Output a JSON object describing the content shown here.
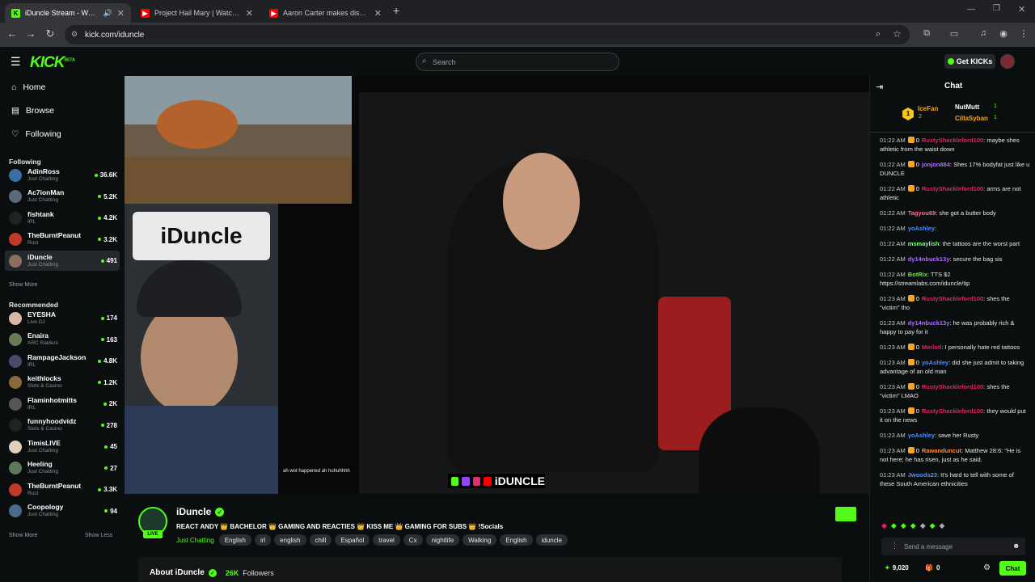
{
  "browser": {
    "tabs": [
      {
        "title": "iDuncle Stream - Watch Live",
        "favicon": "kick-icon",
        "color": "#53fc18"
      },
      {
        "title": "Project Hail Mary | Watch Rocky",
        "favicon": "youtube-icon",
        "color": "#ff0000"
      },
      {
        "title": "Aaron Carter makes diss track o",
        "favicon": "youtube-icon",
        "color": "#ff0000"
      }
    ],
    "url": "kick.com/iduncle"
  },
  "header": {
    "logo": "KICK",
    "logo_sup": "BETA",
    "search_placeholder": "Search",
    "get_kicks": "Get KICKs"
  },
  "sidebar": {
    "nav": [
      {
        "label": "Home",
        "icon": "home-icon"
      },
      {
        "label": "Browse",
        "icon": "browse-icon"
      },
      {
        "label": "Following",
        "icon": "heart-icon"
      }
    ],
    "following_title": "Following",
    "following": [
      {
        "name": "AdinRoss",
        "category": "Just Chatting",
        "viewers": "36.6K",
        "avatar": "#3b6ea5"
      },
      {
        "name": "Ac7ionMan",
        "category": "Just Chatting",
        "viewers": "5.2K",
        "avatar": "#5a6a7a"
      },
      {
        "name": "fishtank",
        "category": "IRL",
        "viewers": "4.2K",
        "avatar": "#222"
      },
      {
        "name": "TheBurntPeanut",
        "category": "Rust",
        "viewers": "3.2K",
        "avatar": "#c0392b"
      },
      {
        "name": "iDuncle",
        "category": "Just Chatting",
        "viewers": "491",
        "avatar": "#8d6e63"
      }
    ],
    "show_more": "Show More",
    "recommended_title": "Recommended",
    "recommended": [
      {
        "name": "EYESHA",
        "category": "Live DJ",
        "viewers": "174",
        "avatar": "#d9b8a6"
      },
      {
        "name": "Enaira",
        "category": "ARC Raiders",
        "viewers": "163",
        "avatar": "#6b7b5a"
      },
      {
        "name": "RampageJackson",
        "category": "IRL",
        "viewers": "4.8K",
        "avatar": "#4a4a6a"
      },
      {
        "name": "keithlocks",
        "category": "Slots & Casino",
        "viewers": "1.2K",
        "avatar": "#8a6a3a"
      },
      {
        "name": "Flaminhotmitts",
        "category": "IRL",
        "viewers": "2K",
        "avatar": "#555"
      },
      {
        "name": "funnyhoodvidz",
        "category": "Slots & Casino",
        "viewers": "278",
        "avatar": "#222"
      },
      {
        "name": "TimisLIVE",
        "category": "Just Chatting",
        "viewers": "45",
        "avatar": "#e0d0c0"
      },
      {
        "name": "Heeling",
        "category": "Just Chatting",
        "viewers": "27",
        "avatar": "#5a7a5a"
      },
      {
        "name": "TheBurntPeanut",
        "category": "Rust",
        "viewers": "3.3K",
        "avatar": "#c0392b"
      },
      {
        "name": "Coopology",
        "category": "Just Chatting",
        "viewers": "94",
        "avatar": "#4a6a8a"
      }
    ],
    "show_more_2": "Show More",
    "show_less": "Show Less"
  },
  "video": {
    "caption": "iDUNCLE",
    "sign": "iDuncle",
    "subtitle": "ah wot happened ah huhuhhhh"
  },
  "stream": {
    "name": "iDuncle",
    "live": "LIVE",
    "title": "REACT ANDY 👑 BACHELOR 👑 GAMING AND REACTIES 👑 KISS ME 👑 GAMING FOR SUBS 👑 !Socials",
    "category": "Just Chatting",
    "tags": [
      "English",
      "irl",
      "english",
      "chill",
      "Español",
      "travel",
      "Cx",
      "nightlife",
      "Walking",
      "English",
      "iduncle"
    ],
    "about": "About iDuncle",
    "followers": "26K",
    "followers_label": "Followers"
  },
  "chat": {
    "title": "Chat",
    "leaders": [
      {
        "name": "IceFan",
        "count": "2",
        "color": "#f5a623"
      },
      {
        "name": "NutMutt",
        "count": "1",
        "color": "#ffffff"
      },
      {
        "name": "CillaSyban",
        "count": "1",
        "color": "#f5a623"
      }
    ],
    "messages": [
      {
        "time": "01:22 AM",
        "badge": "0",
        "user": "RustyShackleford100",
        "color": "#e0245e",
        "text": "maybe shes athletic from the waist down"
      },
      {
        "time": "01:22 AM",
        "badge": "0",
        "user": "jonjon884",
        "color": "#b06bff",
        "text": "Shes 17% bodyfat just like u DUNCLE"
      },
      {
        "time": "01:22 AM",
        "badge": "0",
        "user": "RustyShackleford100",
        "color": "#e0245e",
        "text": "arms are not athletic"
      },
      {
        "time": "01:22 AM",
        "badge": "",
        "user": "Tagyou69",
        "color": "#ff6b9d",
        "text": "she got a butter body"
      },
      {
        "time": "01:22 AM",
        "badge": "",
        "user": "yoAshley",
        "color": "#4a90ff",
        "text": ""
      },
      {
        "time": "01:22 AM",
        "badge": "",
        "user": "msmaylish",
        "color": "#7fff7f",
        "text": "the tattoos are the worst part"
      },
      {
        "time": "01:22 AM",
        "badge": "",
        "user": "dy14nbuck13y",
        "color": "#b06bff",
        "text": "secure the bag sis"
      },
      {
        "time": "01:22 AM",
        "badge": "",
        "user": "BotRix",
        "color": "#53fc18",
        "text": "TTS $2 https://streamlabs.com/iduncle/tip"
      },
      {
        "time": "01:23 AM",
        "badge": "0",
        "user": "RustyShackleford100",
        "color": "#e0245e",
        "text": "shes the \"victim\" tho"
      },
      {
        "time": "01:23 AM",
        "badge": "",
        "user": "dy14nbuck13y",
        "color": "#b06bff",
        "text": "he was probably rich & happy to pay for it"
      },
      {
        "time": "01:23 AM",
        "badge": "0",
        "user": "Merlotl",
        "color": "#e0245e",
        "text": "I personally hate red tattoos"
      },
      {
        "time": "01:23 AM",
        "badge": "0",
        "user": "yoAshley",
        "color": "#4a90ff",
        "text": "did she just admit to taking advantage of an old man"
      },
      {
        "time": "01:23 AM",
        "badge": "0",
        "user": "RustyShackleford100",
        "color": "#e0245e",
        "text": "shes the \"victim\" LMAO"
      },
      {
        "time": "01:23 AM",
        "badge": "0",
        "user": "RustyShackleford100",
        "color": "#e0245e",
        "text": "they would put it on the news"
      },
      {
        "time": "01:23 AM",
        "badge": "",
        "user": "yoAshley",
        "color": "#4a90ff",
        "text": "save her Rusty"
      },
      {
        "time": "01:23 AM",
        "badge": "0",
        "user": "Rawanduncut",
        "color": "#ff8c42",
        "text": "Matthew 28:6: \"He is not here; he has risen, just as he said."
      },
      {
        "time": "01:23 AM",
        "badge": "",
        "user": "Jwoods23",
        "color": "#4a90ff",
        "text": "It's hard to tell with some of these South American ethnicities"
      }
    ],
    "input_placeholder": "Send a message",
    "points": "9,020",
    "gifts": "0",
    "chat_button": "Chat"
  }
}
